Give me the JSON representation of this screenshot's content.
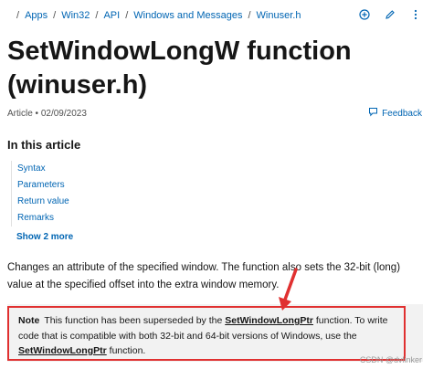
{
  "breadcrumb": {
    "items": [
      "Apps",
      "Win32",
      "API",
      "Windows and Messages",
      "Winuser.h"
    ]
  },
  "toolbar": {
    "icons": [
      "add-icon",
      "edit-icon",
      "more-icon"
    ]
  },
  "header": {
    "title": "SetWindowLongW function (winuser.h)",
    "meta": "Article • 02/09/2023",
    "feedback_label": "Feedback"
  },
  "toc": {
    "heading": "In this article",
    "items": [
      "Syntax",
      "Parameters",
      "Return value",
      "Remarks"
    ],
    "show_more": "Show 2 more"
  },
  "content": {
    "description": "Changes an attribute of the specified window. The function also sets the 32-bit (long) value at the specified offset into the extra window memory."
  },
  "note": {
    "label": "Note",
    "text_1": "This function has been superseded by the ",
    "link_1": "SetWindowLongPtr",
    "text_2": " function. To write code that is compatible with both 32-bit and 64-bit versions of Windows, use the ",
    "link_2": "SetWindowLongPtr",
    "text_3": " function."
  },
  "watermark": "CSDN @dvlinker",
  "colors": {
    "link": "#0065b3",
    "annotation_red": "#e03030",
    "note_bg": "#f2f2f2"
  }
}
